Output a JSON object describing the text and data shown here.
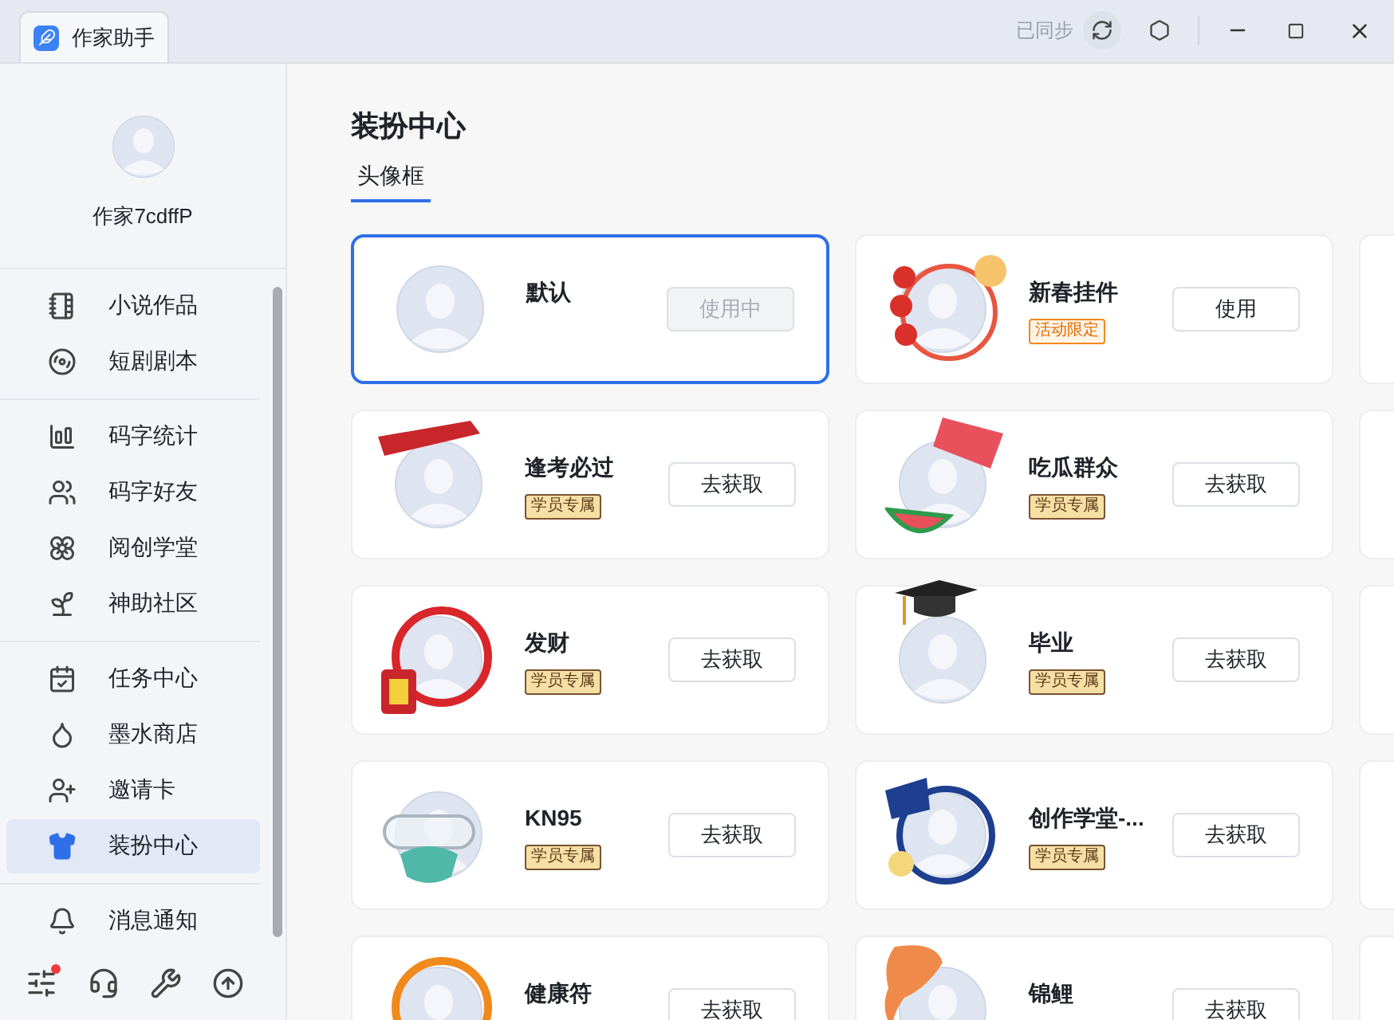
{
  "app_tab": {
    "title": "作家助手"
  },
  "titlebar": {
    "sync_status": "已同步"
  },
  "profile": {
    "username": "作家7cdffP"
  },
  "sidebar": {
    "groups": [
      {
        "items": [
          {
            "label": "小说作品",
            "selected": false
          },
          {
            "label": "短剧剧本",
            "selected": false
          }
        ]
      },
      {
        "items": [
          {
            "label": "码字统计",
            "selected": false
          },
          {
            "label": "码字好友",
            "selected": false
          },
          {
            "label": "阅创学堂",
            "selected": false
          },
          {
            "label": "神助社区",
            "selected": false
          }
        ]
      },
      {
        "items": [
          {
            "label": "任务中心",
            "selected": false
          },
          {
            "label": "墨水商店",
            "selected": false
          },
          {
            "label": "邀请卡",
            "selected": false
          },
          {
            "label": "装扮中心",
            "selected": true
          }
        ]
      },
      {
        "items": [
          {
            "label": "消息通知",
            "selected": false
          }
        ]
      }
    ],
    "footer": {
      "settings_has_alert": true
    }
  },
  "page": {
    "title": "装扮中心",
    "tabs": [
      {
        "label": "头像框",
        "selected": true
      }
    ]
  },
  "frames": [
    {
      "name": "默认",
      "selected": true,
      "button": {
        "label": "使用中",
        "disabled": true
      }
    },
    {
      "name": "新春挂件",
      "selected": false,
      "badge": {
        "text": "活动限定",
        "kind": "limited"
      },
      "button": {
        "label": "使用",
        "disabled": false
      }
    },
    {
      "name": "逢考必过",
      "selected": false,
      "badge": {
        "text": "学员专属",
        "kind": "member"
      },
      "button": {
        "label": "去获取",
        "disabled": false
      }
    },
    {
      "name": "吃瓜群众",
      "selected": false,
      "badge": {
        "text": "学员专属",
        "kind": "member"
      },
      "button": {
        "label": "去获取",
        "disabled": false
      }
    },
    {
      "name": "发财",
      "selected": false,
      "badge": {
        "text": "学员专属",
        "kind": "member"
      },
      "button": {
        "label": "去获取",
        "disabled": false
      }
    },
    {
      "name": "毕业",
      "selected": false,
      "badge": {
        "text": "学员专属",
        "kind": "member"
      },
      "button": {
        "label": "去获取",
        "disabled": false
      }
    },
    {
      "name": "KN95",
      "selected": false,
      "badge": {
        "text": "学员专属",
        "kind": "member"
      },
      "button": {
        "label": "去获取",
        "disabled": false
      }
    },
    {
      "name": "创作学堂-...",
      "selected": false,
      "badge": {
        "text": "学员专属",
        "kind": "member"
      },
      "button": {
        "label": "去获取",
        "disabled": false
      }
    },
    {
      "name": "健康符",
      "selected": false,
      "button": {
        "label": "去获取",
        "disabled": false
      }
    },
    {
      "name": "锦鲤",
      "selected": false,
      "button": {
        "label": "去获取",
        "disabled": false
      }
    }
  ]
}
